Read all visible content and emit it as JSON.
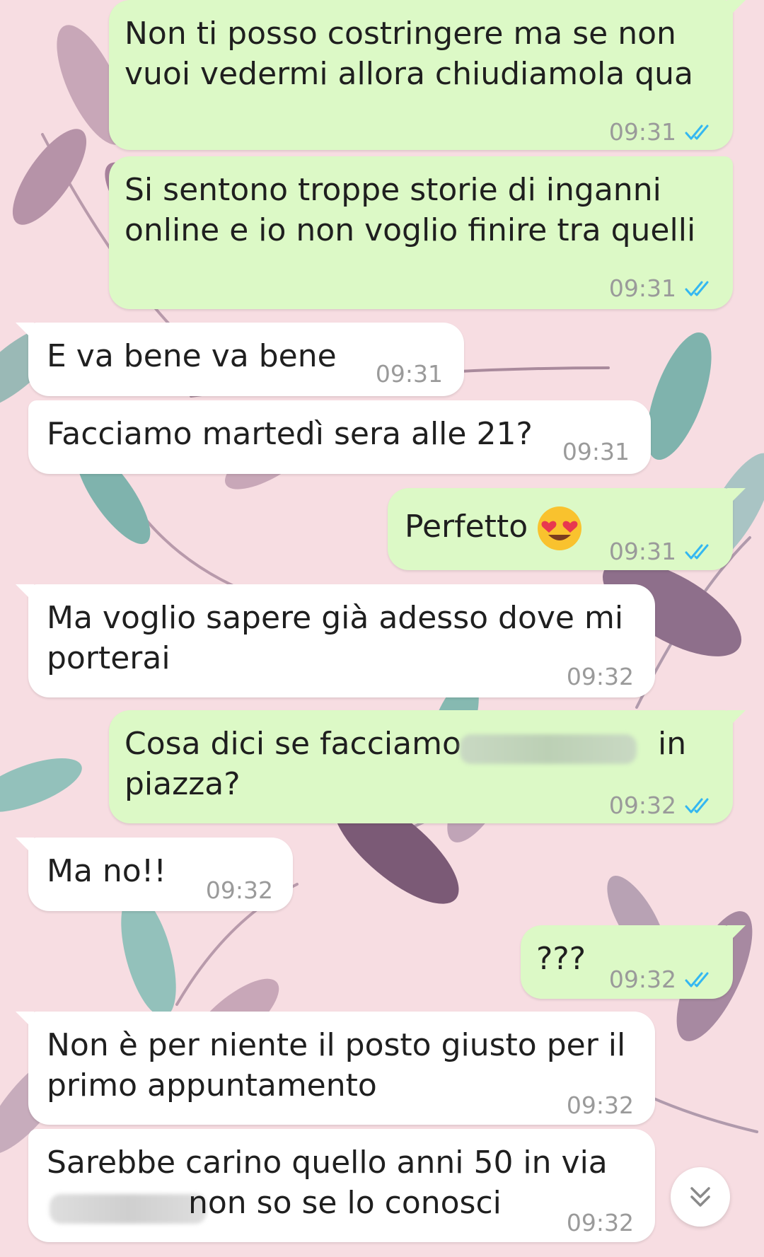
{
  "colors": {
    "outgoing_bubble": "#dcf9c6",
    "incoming_bubble": "#ffffff",
    "read_ticks": "#34b7f1",
    "timestamp": "#9a9a9a",
    "wallpaper": "#f7dde2"
  },
  "messages": [
    {
      "direction": "out",
      "lines": [
        "Non ti posso costringere ma se non",
        "vuoi vedermi allora chiudiamola qua"
      ],
      "time": "09:31",
      "status": "read"
    },
    {
      "direction": "out",
      "lines": [
        "Si sentono troppe storie di inganni",
        "online e io non voglio finire tra quelli"
      ],
      "time": "09:31",
      "status": "read"
    },
    {
      "direction": "in",
      "lines": [
        "E va bene va bene"
      ],
      "time": "09:31"
    },
    {
      "direction": "in",
      "lines": [
        "Facciamo martedì sera alle 21?"
      ],
      "time": "09:31"
    },
    {
      "direction": "out",
      "lines": [
        "Perfetto"
      ],
      "emoji": "heart-eyes-emoji",
      "time": "09:31",
      "status": "read"
    },
    {
      "direction": "in",
      "lines": [
        "Ma voglio sapere già adesso dove mi",
        "porterai"
      ],
      "time": "09:32"
    },
    {
      "direction": "out",
      "lines": [
        "Cosa dici se facciamo",
        "in",
        "piazza?"
      ],
      "redacted": true,
      "time": "09:32",
      "status": "read"
    },
    {
      "direction": "in",
      "lines": [
        "Ma no!!"
      ],
      "time": "09:32"
    },
    {
      "direction": "out",
      "lines": [
        "???"
      ],
      "time": "09:32",
      "status": "read"
    },
    {
      "direction": "in",
      "lines": [
        "Non è per niente il posto giusto per il",
        "primo appuntamento"
      ],
      "time": "09:32"
    },
    {
      "direction": "in",
      "lines": [
        "Sarebbe carino quello anni 50 in via",
        "non so se lo conosci"
      ],
      "redacted": true,
      "time": "09:32"
    }
  ],
  "scroll_button": {
    "icon": "double-chevron-down-icon"
  }
}
